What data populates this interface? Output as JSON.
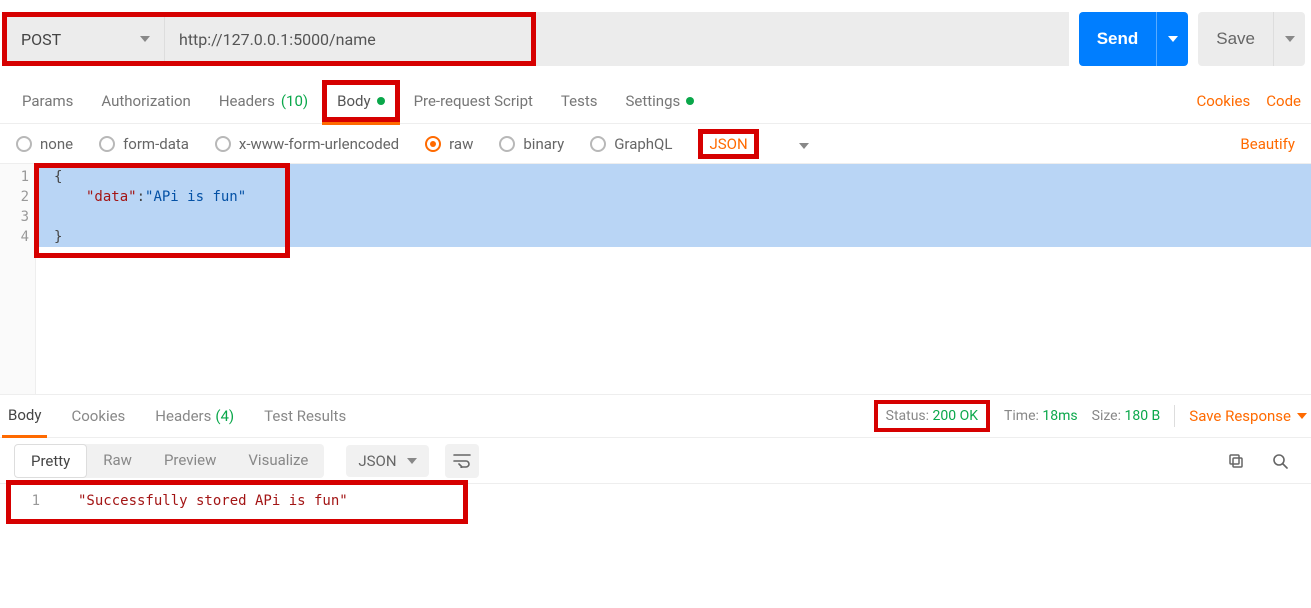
{
  "request": {
    "method": "POST",
    "url": "http://127.0.0.1:5000/name",
    "send_label": "Send",
    "save_label": "Save"
  },
  "tabs": {
    "params": "Params",
    "authorization": "Authorization",
    "headers": "Headers",
    "headers_count": "(10)",
    "body": "Body",
    "prerequest": "Pre-request Script",
    "tests": "Tests",
    "settings": "Settings"
  },
  "tabs_right": {
    "cookies": "Cookies",
    "code": "Code"
  },
  "body_types": {
    "none": "none",
    "formdata": "form-data",
    "xwww": "x-www-form-urlencoded",
    "raw": "raw",
    "binary": "binary",
    "graphql": "GraphQL",
    "json_dd": "JSON",
    "beautify": "Beautify"
  },
  "request_body": {
    "line1": "{",
    "line2_key": "\"data\"",
    "line2_sep": ":",
    "line2_val": "\"APi is fun\"",
    "line4": "}",
    "gutter": [
      "1",
      "2",
      "3",
      "4"
    ]
  },
  "response_tabs": {
    "body": "Body",
    "cookies": "Cookies",
    "headers": "Headers",
    "headers_count": "(4)",
    "test_results": "Test Results"
  },
  "response_meta": {
    "status_label": "Status:",
    "status_value": "200 OK",
    "time_label": "Time:",
    "time_value": "18ms",
    "size_label": "Size:",
    "size_value": "180 B",
    "save_response": "Save Response"
  },
  "response_toolbar": {
    "pretty": "Pretty",
    "raw": "Raw",
    "preview": "Preview",
    "visualize": "Visualize",
    "format_dd": "JSON"
  },
  "response_body": {
    "gutter": "1",
    "line1": "\"Successfully stored  APi is fun\""
  }
}
